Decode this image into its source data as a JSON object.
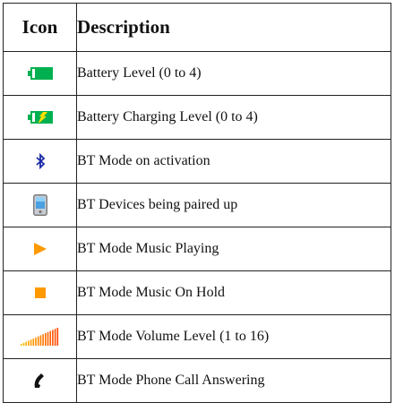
{
  "table": {
    "headers": {
      "icon": "Icon",
      "description": "Description"
    },
    "rows": [
      {
        "icon": "battery-level-icon",
        "description": "Battery Level (0 to 4)"
      },
      {
        "icon": "battery-charging-icon",
        "description": "Battery Charging Level (0 to 4)"
      },
      {
        "icon": "bluetooth-icon",
        "description": "BT Mode on activation"
      },
      {
        "icon": "phone-device-icon",
        "description": "BT Devices being paired up"
      },
      {
        "icon": "play-icon",
        "description": "BT Mode Music Playing"
      },
      {
        "icon": "stop-icon",
        "description": "BT Mode Music On Hold"
      },
      {
        "icon": "volume-bars-icon",
        "description": "BT Mode Volume Level (1 to 16)"
      },
      {
        "icon": "phone-handset-icon",
        "description": "BT Mode Phone Call Answering"
      }
    ]
  },
  "colors": {
    "battery_green": "#00b050",
    "charging_yellow": "#ffe000",
    "bluetooth_blue": "#1a2aa8",
    "accent_orange": "#ff9900"
  }
}
